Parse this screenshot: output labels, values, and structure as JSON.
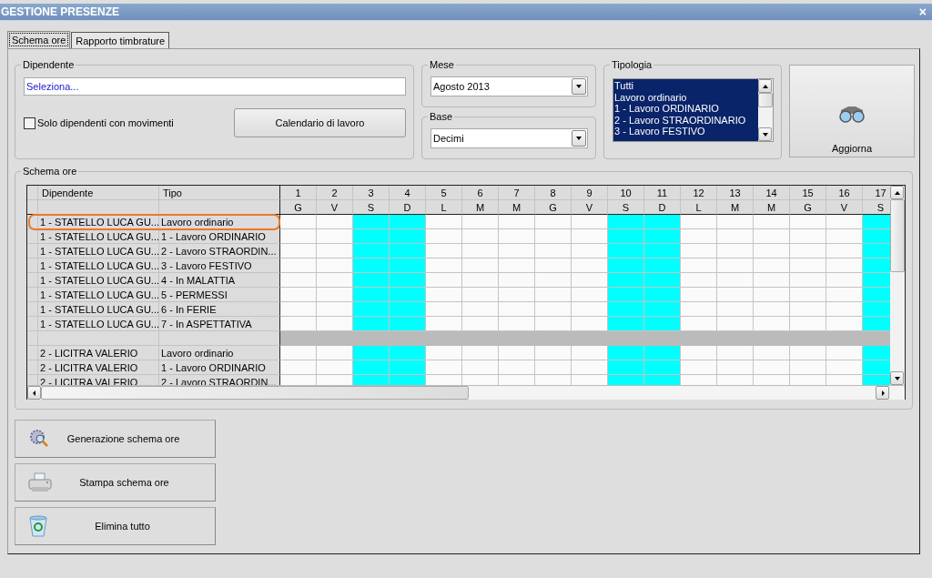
{
  "window": {
    "title": "GESTIONE PRESENZE",
    "close": "×"
  },
  "tabs": [
    {
      "label": "Schema ore",
      "selected": true
    },
    {
      "label": "Rapporto timbrature",
      "selected": false
    }
  ],
  "dipendente": {
    "legend": "Dipendente",
    "value": "Seleziona...",
    "checkbox": {
      "label": "Solo dipendenti con movimenti",
      "checked": false
    },
    "button": "Calendario di lavoro"
  },
  "mese": {
    "legend": "Mese",
    "value": "Agosto 2013"
  },
  "base": {
    "legend": "Base",
    "value": "Decimi"
  },
  "tipologia": {
    "legend": "Tipologia",
    "items": [
      {
        "label": "Tutti",
        "selected": true
      },
      {
        "label": "Lavoro ordinario",
        "selected": true
      },
      {
        "label": "1 - Lavoro ORDINARIO",
        "selected": true
      },
      {
        "label": "2 - Lavoro STRAORDINARIO",
        "selected": true
      },
      {
        "label": "3 - Lavoro FESTIVO",
        "selected": true
      }
    ]
  },
  "aggiorna": {
    "label": "Aggiorna"
  },
  "schema": {
    "legend": "Schema ore",
    "columns": [
      "Dipendente",
      "Tipo"
    ],
    "days": [
      {
        "day": "1",
        "weekday": "G",
        "weekend": false
      },
      {
        "day": "2",
        "weekday": "V",
        "weekend": false
      },
      {
        "day": "3",
        "weekday": "S",
        "weekend": true
      },
      {
        "day": "4",
        "weekday": "D",
        "weekend": true
      },
      {
        "day": "5",
        "weekday": "L",
        "weekend": false
      },
      {
        "day": "6",
        "weekday": "M",
        "weekend": false
      },
      {
        "day": "7",
        "weekday": "M",
        "weekend": false
      },
      {
        "day": "8",
        "weekday": "G",
        "weekend": false
      },
      {
        "day": "9",
        "weekday": "V",
        "weekend": false
      },
      {
        "day": "10",
        "weekday": "S",
        "weekend": true
      },
      {
        "day": "11",
        "weekday": "D",
        "weekend": true
      },
      {
        "day": "12",
        "weekday": "L",
        "weekend": false
      },
      {
        "day": "13",
        "weekday": "M",
        "weekend": false
      },
      {
        "day": "14",
        "weekday": "M",
        "weekend": false
      },
      {
        "day": "15",
        "weekday": "G",
        "weekend": false
      },
      {
        "day": "16",
        "weekday": "V",
        "weekend": false
      },
      {
        "day": "17",
        "weekday": "S",
        "weekend": true
      }
    ],
    "rows": [
      {
        "kind": "data",
        "dipendente": "1 - STATELLO LUCA GU...",
        "tipo": "Lavoro ordinario",
        "selected": true
      },
      {
        "kind": "data",
        "dipendente": "1 - STATELLO LUCA GU...",
        "tipo": "1 - Lavoro ORDINARIO",
        "selected": false
      },
      {
        "kind": "data",
        "dipendente": "1 - STATELLO LUCA GU...",
        "tipo": "2 - Lavoro STRAORDIN...",
        "selected": false
      },
      {
        "kind": "data",
        "dipendente": "1 - STATELLO LUCA GU...",
        "tipo": "3 - Lavoro FESTIVO",
        "selected": false
      },
      {
        "kind": "data",
        "dipendente": "1 - STATELLO LUCA GU...",
        "tipo": "4 - In MALATTIA",
        "selected": false
      },
      {
        "kind": "data",
        "dipendente": "1 - STATELLO LUCA GU...",
        "tipo": "5 - PERMESSI",
        "selected": false
      },
      {
        "kind": "data",
        "dipendente": "1 - STATELLO LUCA GU...",
        "tipo": "6 - In FERIE",
        "selected": false
      },
      {
        "kind": "data",
        "dipendente": "1 - STATELLO LUCA GU...",
        "tipo": "7 - In ASPETTATIVA",
        "selected": false
      },
      {
        "kind": "separator",
        "selected": false
      },
      {
        "kind": "data",
        "dipendente": "2 - LICITRA VALERIO",
        "tipo": "Lavoro ordinario",
        "selected": false
      },
      {
        "kind": "data",
        "dipendente": "2 - LICITRA VALERIO",
        "tipo": "1 - Lavoro ORDINARIO",
        "selected": false
      },
      {
        "kind": "data",
        "dipendente": "2 - LICITRA VALERIO",
        "tipo": "2 - Lavoro STRAORDIN...",
        "selected": false
      }
    ]
  },
  "actions": [
    {
      "kind": "generate",
      "label": "Generazione schema ore"
    },
    {
      "kind": "print",
      "label": "Stampa schema ore"
    },
    {
      "kind": "delete",
      "label": "Elimina tutto"
    }
  ]
}
